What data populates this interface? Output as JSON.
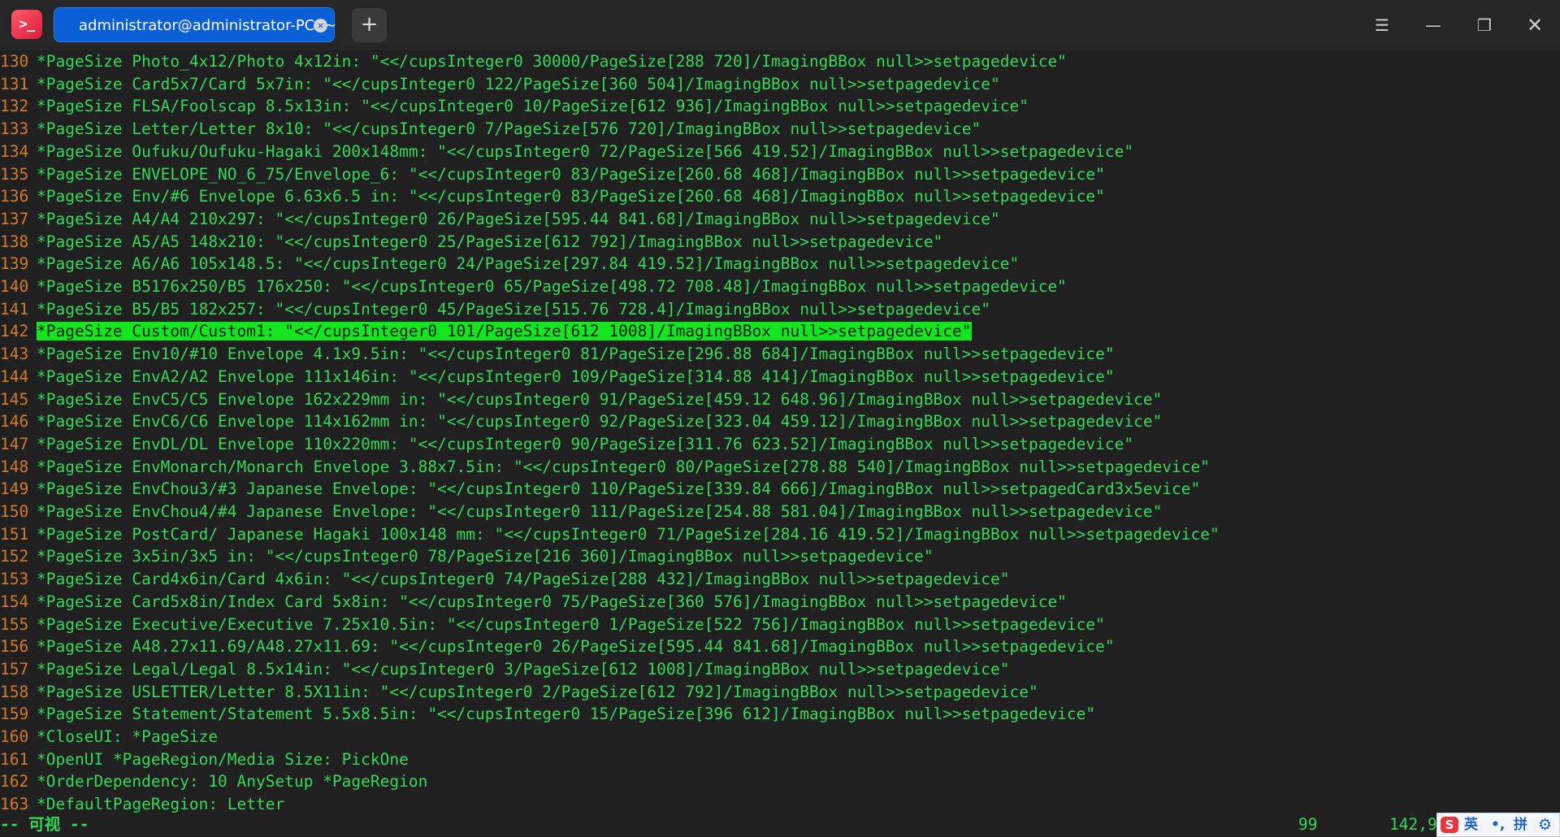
{
  "titlebar": {
    "app_icon": ">_",
    "tab_title": "administrator@administrator-PC: ~",
    "tab_close": "×",
    "new_tab": "+",
    "menu": "☰",
    "minimize": "—",
    "maximize": "❐",
    "close": "✕"
  },
  "terminal": {
    "highlight_line": 142,
    "lines": [
      {
        "num": "130",
        "text": "*PageSize Photo_4x12/Photo 4x12in: \"<</cupsInteger0 30000/PageSize[288 720]/ImagingBBox null>>setpagedevice\""
      },
      {
        "num": "131",
        "text": "*PageSize Card5x7/Card 5x7in: \"<</cupsInteger0 122/PageSize[360 504]/ImagingBBox null>>setpagedevice\""
      },
      {
        "num": "132",
        "text": "*PageSize FLSA/Foolscap 8.5x13in: \"<</cupsInteger0 10/PageSize[612 936]/ImagingBBox null>>setpagedevice\""
      },
      {
        "num": "133",
        "text": "*PageSize Letter/Letter 8x10: \"<</cupsInteger0 7/PageSize[576 720]/ImagingBBox null>>setpagedevice\""
      },
      {
        "num": "134",
        "text": "*PageSize Oufuku/Oufuku-Hagaki 200x148mm: \"<</cupsInteger0 72/PageSize[566 419.52]/ImagingBBox null>>setpagedevice\""
      },
      {
        "num": "135",
        "text": "*PageSize ENVELOPE_NO_6_75/Envelope_6: \"<</cupsInteger0 83/PageSize[260.68 468]/ImagingBBox null>>setpagedevice\""
      },
      {
        "num": "136",
        "text": "*PageSize Env/#6 Envelope 6.63x6.5 in: \"<</cupsInteger0 83/PageSize[260.68 468]/ImagingBBox null>>setpagedevice\""
      },
      {
        "num": "137",
        "text": "*PageSize A4/A4 210x297: \"<</cupsInteger0 26/PageSize[595.44 841.68]/ImagingBBox null>>setpagedevice\""
      },
      {
        "num": "138",
        "text": "*PageSize A5/A5 148x210: \"<</cupsInteger0 25/PageSize[612 792]/ImagingBBox null>>setpagedevice\""
      },
      {
        "num": "139",
        "text": "*PageSize A6/A6 105x148.5: \"<</cupsInteger0 24/PageSize[297.84 419.52]/ImagingBBox null>>setpagedevice\""
      },
      {
        "num": "140",
        "text": "*PageSize B5176x250/B5 176x250: \"<</cupsInteger0 65/PageSize[498.72 708.48]/ImagingBBox null>>setpagedevice\""
      },
      {
        "num": "141",
        "text": "*PageSize B5/B5 182x257: \"<</cupsInteger0 45/PageSize[515.76 728.4]/ImagingBBox null>>setpagedevice\""
      },
      {
        "num": "142",
        "text": "*PageSize Custom/Custom1: \"<</cupsInteger0 101/PageSize[612 1008]/ImagingBBox null>>setpagedevice\""
      },
      {
        "num": "143",
        "text": "*PageSize Env10/#10 Envelope 4.1x9.5in: \"<</cupsInteger0 81/PageSize[296.88 684]/ImagingBBox null>>setpagedevice\""
      },
      {
        "num": "144",
        "text": "*PageSize EnvA2/A2 Envelope 111x146in: \"<</cupsInteger0 109/PageSize[314.88 414]/ImagingBBox null>>setpagedevice\""
      },
      {
        "num": "145",
        "text": "*PageSize EnvC5/C5 Envelope 162x229mm in: \"<</cupsInteger0 91/PageSize[459.12 648.96]/ImagingBBox null>>setpagedevice\""
      },
      {
        "num": "146",
        "text": "*PageSize EnvC6/C6 Envelope 114x162mm in: \"<</cupsInteger0 92/PageSize[323.04 459.12]/ImagingBBox null>>setpagedevice\""
      },
      {
        "num": "147",
        "text": "*PageSize EnvDL/DL Envelope 110x220mm: \"<</cupsInteger0 90/PageSize[311.76 623.52]/ImagingBBox null>>setpagedevice\""
      },
      {
        "num": "148",
        "text": "*PageSize EnvMonarch/Monarch Envelope 3.88x7.5in: \"<</cupsInteger0 80/PageSize[278.88 540]/ImagingBBox null>>setpagedevice\""
      },
      {
        "num": "149",
        "text": "*PageSize EnvChou3/#3 Japanese Envelope: \"<</cupsInteger0 110/PageSize[339.84 666]/ImagingBBox null>>setpagedCard3x5evice\""
      },
      {
        "num": "150",
        "text": "*PageSize EnvChou4/#4 Japanese Envelope: \"<</cupsInteger0 111/PageSize[254.88 581.04]/ImagingBBox null>>setpagedevice\""
      },
      {
        "num": "151",
        "text": "*PageSize PostCard/ Japanese Hagaki 100x148 mm: \"<</cupsInteger0 71/PageSize[284.16 419.52]/ImagingBBox null>>setpagedevice\""
      },
      {
        "num": "152",
        "text": "*PageSize 3x5in/3x5 in: \"<</cupsInteger0 78/PageSize[216 360]/ImagingBBox null>>setpagedevice\""
      },
      {
        "num": "153",
        "text": "*PageSize Card4x6in/Card 4x6in: \"<</cupsInteger0 74/PageSize[288 432]/ImagingBBox null>>setpagedevice\""
      },
      {
        "num": "154",
        "text": "*PageSize Card5x8in/Index Card 5x8in: \"<</cupsInteger0 75/PageSize[360 576]/ImagingBBox null>>setpagedevice\""
      },
      {
        "num": "155",
        "text": "*PageSize Executive/Executive 7.25x10.5in: \"<</cupsInteger0 1/PageSize[522 756]/ImagingBBox null>>setpagedevice\""
      },
      {
        "num": "156",
        "text": "*PageSize A48.27x11.69/A48.27x11.69: \"<</cupsInteger0 26/PageSize[595.44 841.68]/ImagingBBox null>>setpagedevice\""
      },
      {
        "num": "157",
        "text": "*PageSize Legal/Legal 8.5x14in: \"<</cupsInteger0 3/PageSize[612 1008]/ImagingBBox null>>setpagedevice\""
      },
      {
        "num": "158",
        "text": "*PageSize USLETTER/Letter 8.5X11in: \"<</cupsInteger0 2/PageSize[612 792]/ImagingBBox null>>setpagedevice\""
      },
      {
        "num": "159",
        "text": "*PageSize Statement/Statement 5.5x8.5in: \"<</cupsInteger0 15/PageSize[396 612]/ImagingBBox null>>setpagedevice\""
      },
      {
        "num": "160",
        "text": "*CloseUI: *PageSize"
      },
      {
        "num": "161",
        "text": "*OpenUI *PageRegion/Media Size: PickOne"
      },
      {
        "num": "162",
        "text": "*OrderDependency: 10 AnySetup *PageRegion"
      },
      {
        "num": "163",
        "text": "*DefaultPageRegion: Letter"
      }
    ]
  },
  "statusline": {
    "mode": "-- 可视 --",
    "count": "99",
    "position": "142,9"
  },
  "ime": {
    "logo": "S",
    "lang": "英",
    "punct": "•,",
    "pinyin": "拼",
    "settings": "⚙"
  },
  "colors": {
    "background": "#202020",
    "text_green": "#37d85a",
    "line_number": "#d47a2c",
    "highlight": "#13e61e",
    "tab_blue": "#0a5fd6"
  }
}
